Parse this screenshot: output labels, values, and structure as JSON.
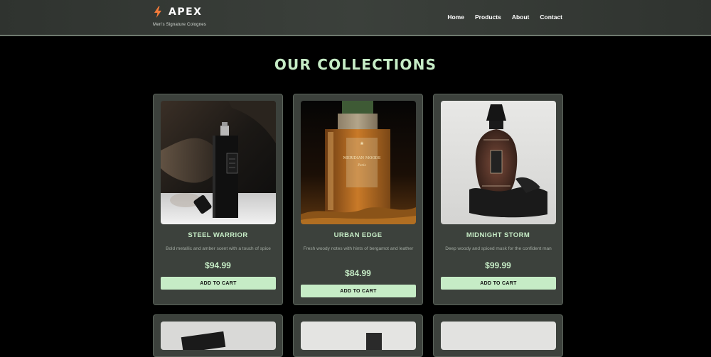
{
  "header": {
    "brand_name": "APEX",
    "tagline": "Men's Signature Colognes",
    "nav": [
      "Home",
      "Products",
      "About",
      "Contact"
    ],
    "accent_color": "#c6ecc6",
    "bolt_color": "#f47b3a"
  },
  "section_title": "OUR COLLECTIONS",
  "products": [
    {
      "name": "STEEL WARRIOR",
      "description": "Bold metallic and amber scent with a touch of spice",
      "price": "$94.99",
      "cart_label": "ADD TO CART"
    },
    {
      "name": "URBAN EDGE",
      "description": "Fresh woody notes with hints of bergamot and leather",
      "price": "$84.99",
      "cart_label": "ADD TO CART",
      "bottle_text": [
        "MERIDIAN MOODS",
        "Paris"
      ]
    },
    {
      "name": "MIDNIGHT STORM",
      "description": "Deep woody and spiced musk for the confident man",
      "price": "$99.99",
      "cart_label": "ADD TO CART"
    }
  ]
}
